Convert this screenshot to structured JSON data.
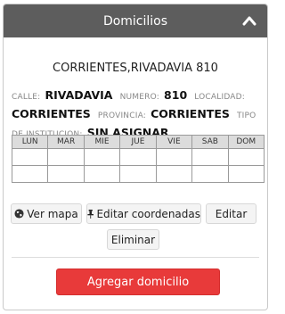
{
  "panel": {
    "title": "Domicilios",
    "collapse_icon": "chevron-up-icon"
  },
  "address": {
    "title": "CORRIENTES,RIVADAVIA 810",
    "fields": {
      "calle_label": "CALLE:",
      "calle_value": "RIVADAVIA",
      "numero_label": "NUMERO:",
      "numero_value": "810",
      "localidad_label": "LOCALIDAD:",
      "localidad_value": "CORRIENTES",
      "provincia_label": "PROVINCIA:",
      "provincia_value": "CORRIENTES",
      "tipo_label": "TIPO DE INSTITUCION:",
      "tipo_value": "SIN ASIGNAR"
    }
  },
  "schedule": {
    "days": [
      "LUN",
      "MAR",
      "MIE",
      "JUE",
      "VIE",
      "SAB",
      "DOM"
    ]
  },
  "actions": {
    "ver_mapa": "Ver mapa",
    "ver_mapa_icon": "globe-icon",
    "editar_coordenadas": "Editar coordenadas",
    "editar_coordenadas_icon": "pushpin-icon",
    "editar": "Editar",
    "eliminar": "Eliminar"
  },
  "footer": {
    "add_label": "Agregar domicilio"
  },
  "colors": {
    "header_bg": "#5d5d5d",
    "primary_red": "#e83a3a",
    "table_header_bg": "#dcdcdc"
  }
}
